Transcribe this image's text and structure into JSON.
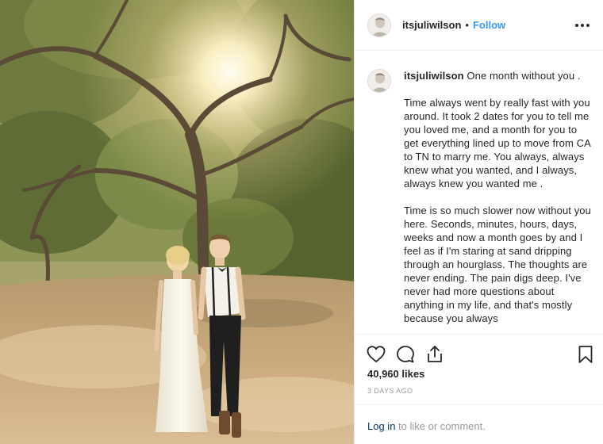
{
  "post": {
    "username": "itsjuliwilson",
    "dot": "•",
    "follow_label": "Follow",
    "more_label": "More options",
    "caption_username": "itsjuliwilson",
    "caption_intro": "One month without you .",
    "caption_paragraph_1": "Time always went by really fast with you around. It took 2 dates for you to tell me you loved me, and a month for you to get everything lined up to move from CA to TN to marry me. You always, always knew what you wanted, and I always, always knew you wanted me .",
    "caption_paragraph_2": "Time is so much slower now without you here. Seconds, minutes, hours, days, weeks and now a month goes by and I feel as if I'm staring at sand dripping through an hourglass. The thoughts are never ending. The pain digs deep. I've never had more questions about anything in my life, and that's mostly because you always",
    "likes": "40,960 likes",
    "date": "3 DAYS AGO",
    "login_label": "Log in",
    "comment_suffix": " to like or comment."
  },
  "icons": {
    "like": "heart-icon",
    "comment": "comment-icon",
    "share": "share-icon",
    "save": "bookmark-icon",
    "more": "more-horizontal-icon"
  },
  "colors": {
    "link_blue": "#3897f0",
    "login_blue": "#003569",
    "text": "#262626",
    "muted": "#999999",
    "divider": "#efefef"
  }
}
